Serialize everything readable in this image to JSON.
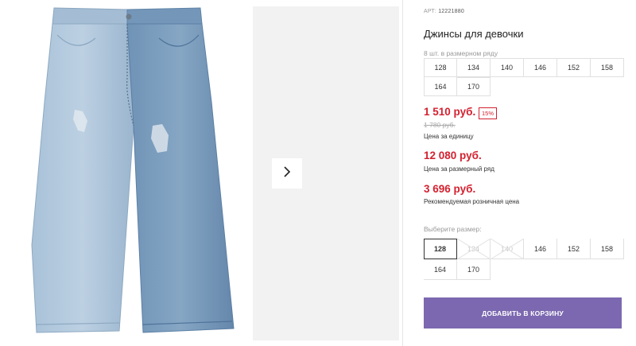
{
  "product": {
    "article_label": "АРТ:",
    "article_number": "12221880",
    "title": "Джинсы для девочки"
  },
  "size_run": {
    "caption": "8 шт. в размерном ряду",
    "sizes": [
      "128",
      "134",
      "140",
      "146",
      "152",
      "158",
      "164",
      "170"
    ]
  },
  "prices": {
    "unit_price": "1 510 руб.",
    "discount_badge": "15%",
    "old_price": "1 780 руб.",
    "unit_caption": "Цена за единицу",
    "run_price": "12 080 руб.",
    "run_caption": "Цена за размерный ряд",
    "retail_price": "3 696 руб.",
    "retail_caption": "Рекомендуемая розничная цена"
  },
  "size_select": {
    "caption": "Выберите размер:",
    "options": [
      {
        "label": "128",
        "state": "selected"
      },
      {
        "label": "134",
        "state": "unavailable"
      },
      {
        "label": "140",
        "state": "unavailable"
      },
      {
        "label": "146",
        "state": "available"
      },
      {
        "label": "152",
        "state": "available"
      },
      {
        "label": "158",
        "state": "available"
      },
      {
        "label": "164",
        "state": "available"
      },
      {
        "label": "170",
        "state": "available"
      }
    ]
  },
  "cart_button_label": "ДОБАВИТЬ В КОРЗИНУ",
  "colors": {
    "accent_price": "#d3212f",
    "cart_button": "#7b68b0",
    "next_panel_bg": "#f2f2f2"
  },
  "icons": {
    "gallery_next": "chevron-right-icon"
  }
}
